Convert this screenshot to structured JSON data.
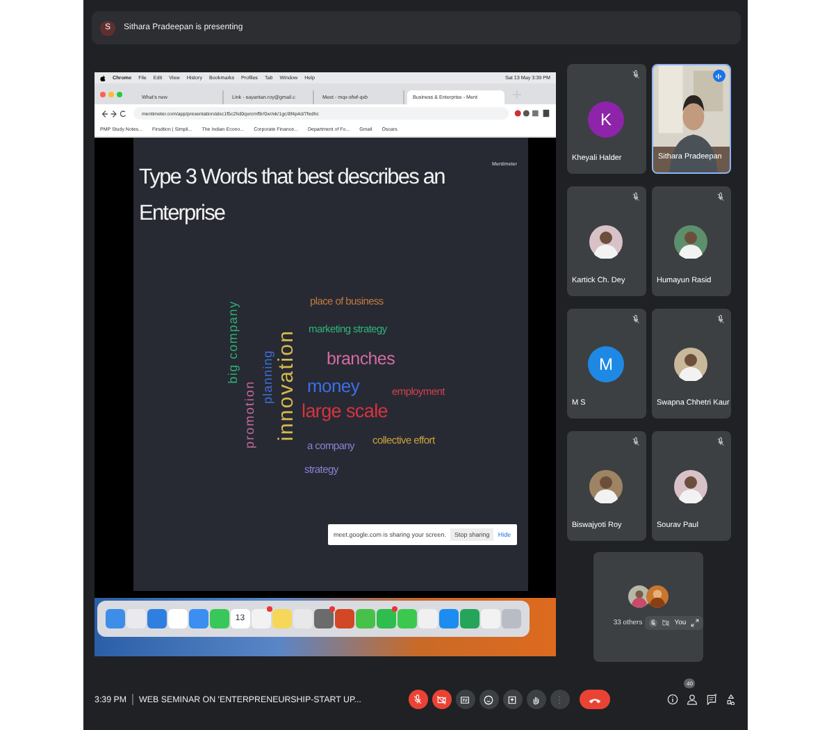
{
  "presenting_banner": {
    "initial": "S",
    "text": "Sithara Pradeepan is presenting"
  },
  "shared_screen": {
    "menu_bar": {
      "app": "Chrome",
      "items": [
        "File",
        "Edit",
        "View",
        "History",
        "Bookmarks",
        "Profiles",
        "Tab",
        "Window",
        "Help"
      ],
      "clock": "Sat 13 May 3:39 PM"
    },
    "tabs": [
      {
        "title": "What's new",
        "selected": false
      },
      {
        "title": "Link - sayantan.roy@gmail.c",
        "selected": false
      },
      {
        "title": "Meet - mqx-sfwf-qxb",
        "selected": false
      },
      {
        "title": "Business & Enterprise - Ment",
        "selected": true
      }
    ],
    "url": "mentimeter.com/app/presentation/alxc1f5c2hd0qxrcmf9r/0xr/ek/1gc/8f4p4d/7fedhc",
    "bookmarks": [
      "PMP Study Notes...",
      "Firsdtion | Simpli...",
      "The Indian Econo...",
      "Corporate Finance...",
      "Department of Fo...",
      "Gmail",
      "Oscars"
    ],
    "slide": {
      "title": "Type 3 Words that best describes an Enterprise",
      "brand": "Mentimeter",
      "words": [
        {
          "text": "big company",
          "color": "#2fae74"
        },
        {
          "text": "promotion",
          "color": "#c46a9c"
        },
        {
          "text": "planning",
          "color": "#3f6fd9"
        },
        {
          "text": "innovation",
          "color": "#d6b94c"
        },
        {
          "text": "place of business",
          "color": "#c57a3e"
        },
        {
          "text": "marketing strategy",
          "color": "#30b477"
        },
        {
          "text": "branches",
          "color": "#d46ca2"
        },
        {
          "text": "money",
          "color": "#3d6ee8"
        },
        {
          "text": "employment",
          "color": "#d2414c"
        },
        {
          "text": "large scale",
          "color": "#d8333f"
        },
        {
          "text": "a company",
          "color": "#8a82d6"
        },
        {
          "text": "collective effort",
          "color": "#c6a23c"
        },
        {
          "text": "strategy",
          "color": "#8a82d6"
        }
      ]
    },
    "share_notice": {
      "text": "meet.google.com is sharing your screen.",
      "stop": "Stop sharing",
      "hide": "Hide"
    },
    "dock": {
      "calendar_day": "13"
    }
  },
  "participants": [
    {
      "name": "Kheyali Halder",
      "kind": "letter",
      "initial": "K",
      "color": "#8e24aa",
      "speaking": false
    },
    {
      "name": "Sithara Pradeepan",
      "kind": "video",
      "speaking": true
    },
    {
      "name": "Kartick Ch. Dey",
      "speaking": false
    },
    {
      "name": "Humayun Rasid",
      "speaking": false
    },
    {
      "name": "M S",
      "kind": "letter",
      "initial": "M",
      "color": "#1e88e5",
      "speaking": false
    },
    {
      "name": "Swapna Chhetri Kaur",
      "speaking": false
    },
    {
      "name": "Biswajyoti Roy",
      "speaking": false
    },
    {
      "name": "Sourav Paul",
      "speaking": false
    }
  ],
  "others": {
    "label": "33 others",
    "self": "You"
  },
  "meeting": {
    "time": "3:39 PM",
    "title": "WEB SEMINAR ON 'ENTERPRENEURSHIP-START UP..."
  },
  "controls": [
    {
      "kind": "mic",
      "on": false
    },
    {
      "kind": "camera",
      "on": false
    },
    {
      "kind": "captions"
    },
    {
      "kind": "emoji"
    },
    {
      "kind": "present"
    },
    {
      "kind": "hand"
    },
    {
      "kind": "more"
    },
    {
      "kind": "leave"
    }
  ],
  "side_icons": {
    "people_count": "40"
  }
}
